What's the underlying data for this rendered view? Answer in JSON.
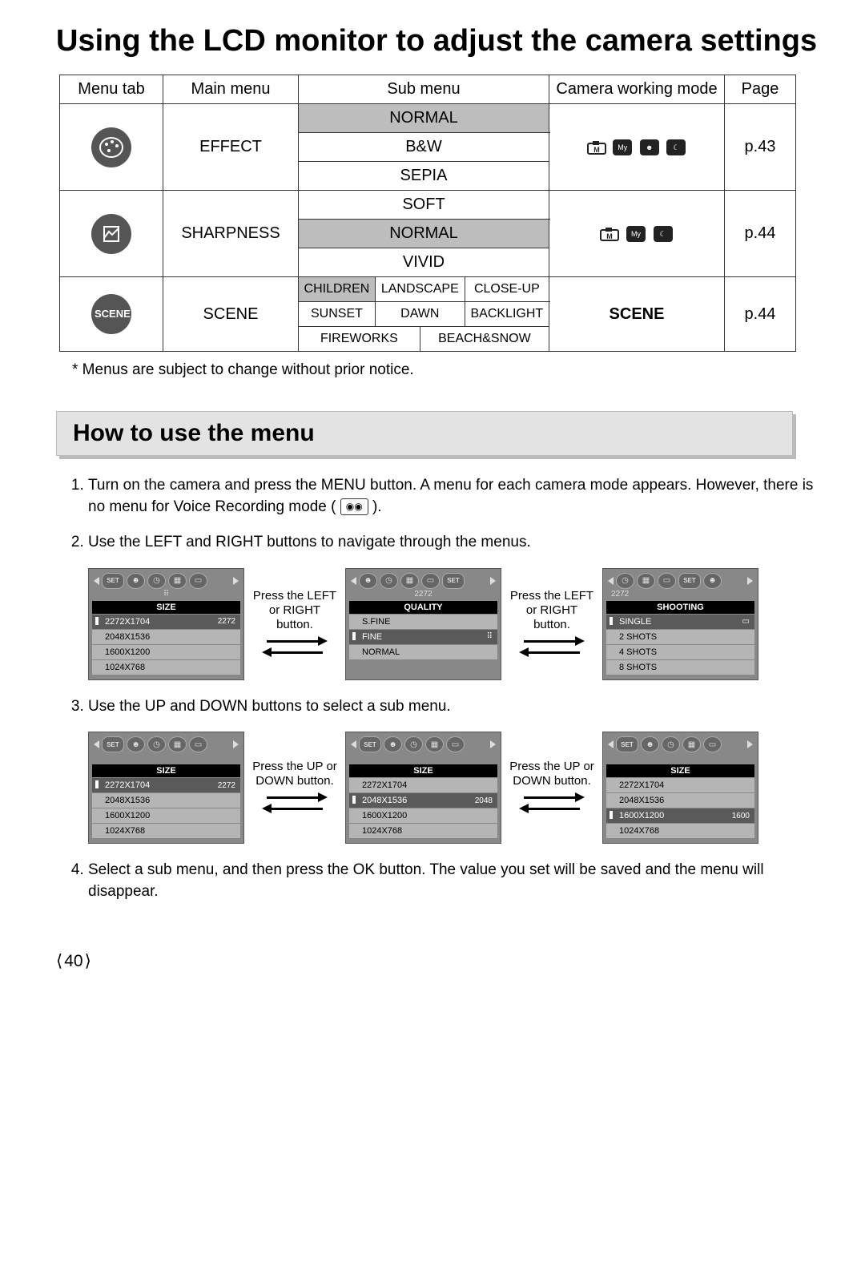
{
  "title": "Using the LCD monitor to adjust the camera settings",
  "table": {
    "headers": [
      "Menu tab",
      "Main menu",
      "Sub menu",
      "Camera working mode",
      "Page"
    ],
    "rows": [
      {
        "main": "EFFECT",
        "subs": [
          "NORMAL",
          "B&W",
          "SEPIA"
        ],
        "shaded_idx": 0,
        "mode_label": "",
        "page": "p.43"
      },
      {
        "main": "SHARPNESS",
        "subs": [
          "SOFT",
          "NORMAL",
          "VIVID"
        ],
        "shaded_idx": 1,
        "mode_label": "",
        "page": "p.44"
      },
      {
        "main": "SCENE",
        "scene_grid": [
          [
            "CHILDREN",
            "LANDSCAPE",
            "CLOSE-UP"
          ],
          [
            "SUNSET",
            "DAWN",
            "BACKLIGHT"
          ],
          [
            "FIREWORKS",
            "BEACH&SNOW"
          ]
        ],
        "mode_label": "SCENE",
        "page": "p.44"
      }
    ]
  },
  "note": "* Menus are subject to change without prior notice.",
  "section2_heading": "How to use the menu",
  "steps": {
    "s1a": "Turn on the camera and press the MENU button. A menu for each camera mode appears. However, there is no menu for Voice Recording mode (",
    "s1b": ").",
    "s2": "Use the LEFT and RIGHT buttons to navigate through the menus.",
    "s3": "Use the UP and DOWN buttons to select a sub menu.",
    "s4": "Select a sub menu, and then press the OK button. The value you set will be saved and the menu will disappear."
  },
  "arrow_captions": {
    "lr": "Press the LEFT or RIGHT button.",
    "ud": "Press the UP or DOWN button."
  },
  "lcd": {
    "size_header": "SIZE",
    "quality_header": "QUALITY",
    "shooting_header": "SHOOTING",
    "size_items": [
      "2272X1704",
      "2048X1536",
      "1600X1200",
      "1024X768"
    ],
    "size_tags": {
      "2272X1704": "2272",
      "2048X1536": "2048",
      "1600X1200": "1600"
    },
    "quality_items": [
      "S.FINE",
      "FINE",
      "NORMAL"
    ],
    "shooting_items": [
      "SINGLE",
      "2 SHOTS",
      "4 SHOTS",
      "8 SHOTS"
    ],
    "sublabel_2272": "2272",
    "set_label": "SET"
  },
  "mode_my": "My",
  "scene_icon_label": "SCENE",
  "page_number": "40"
}
